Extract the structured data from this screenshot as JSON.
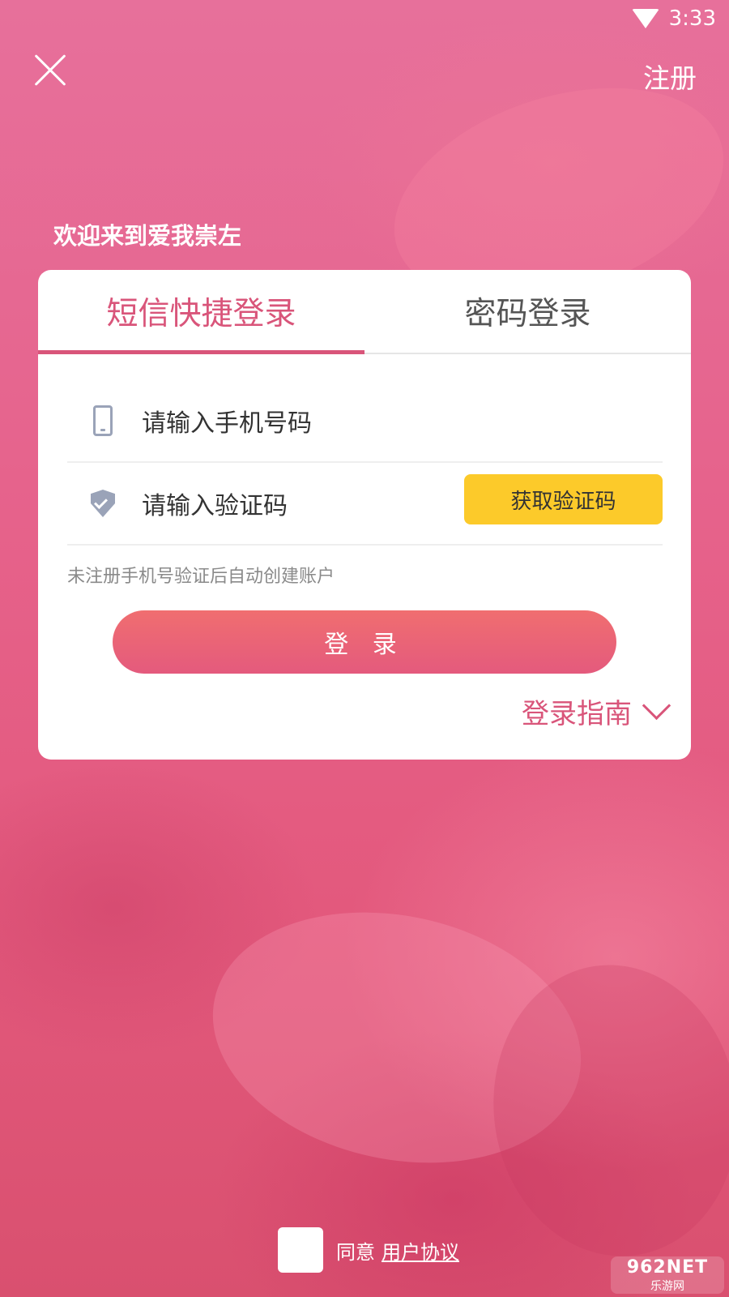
{
  "status_bar": {
    "time": "3:33",
    "wifi_icon": "wifi-icon"
  },
  "header": {
    "close_icon": "close-icon",
    "register_label": "注册"
  },
  "welcome_text": "欢迎来到爱我崇左",
  "tabs": [
    {
      "label": "短信快捷登录",
      "active": true
    },
    {
      "label": "密码登录",
      "active": false
    }
  ],
  "phone_field": {
    "icon": "phone-icon",
    "placeholder": "请输入手机号码"
  },
  "code_field": {
    "icon": "shield-check-icon",
    "placeholder": "请输入验证码",
    "button_label": "获取验证码"
  },
  "hint": "未注册手机号验证后自动创建账户",
  "login_button": "登 录",
  "guide": {
    "label": "登录指南",
    "icon": "chevron-down-icon"
  },
  "agreement": {
    "checked": false,
    "prefix": "同意",
    "link": "用户协议"
  },
  "watermark": {
    "top": "962NET",
    "bottom": "乐游网"
  },
  "colors": {
    "accent": "#d9557a",
    "code_button": "#fcca2a"
  }
}
